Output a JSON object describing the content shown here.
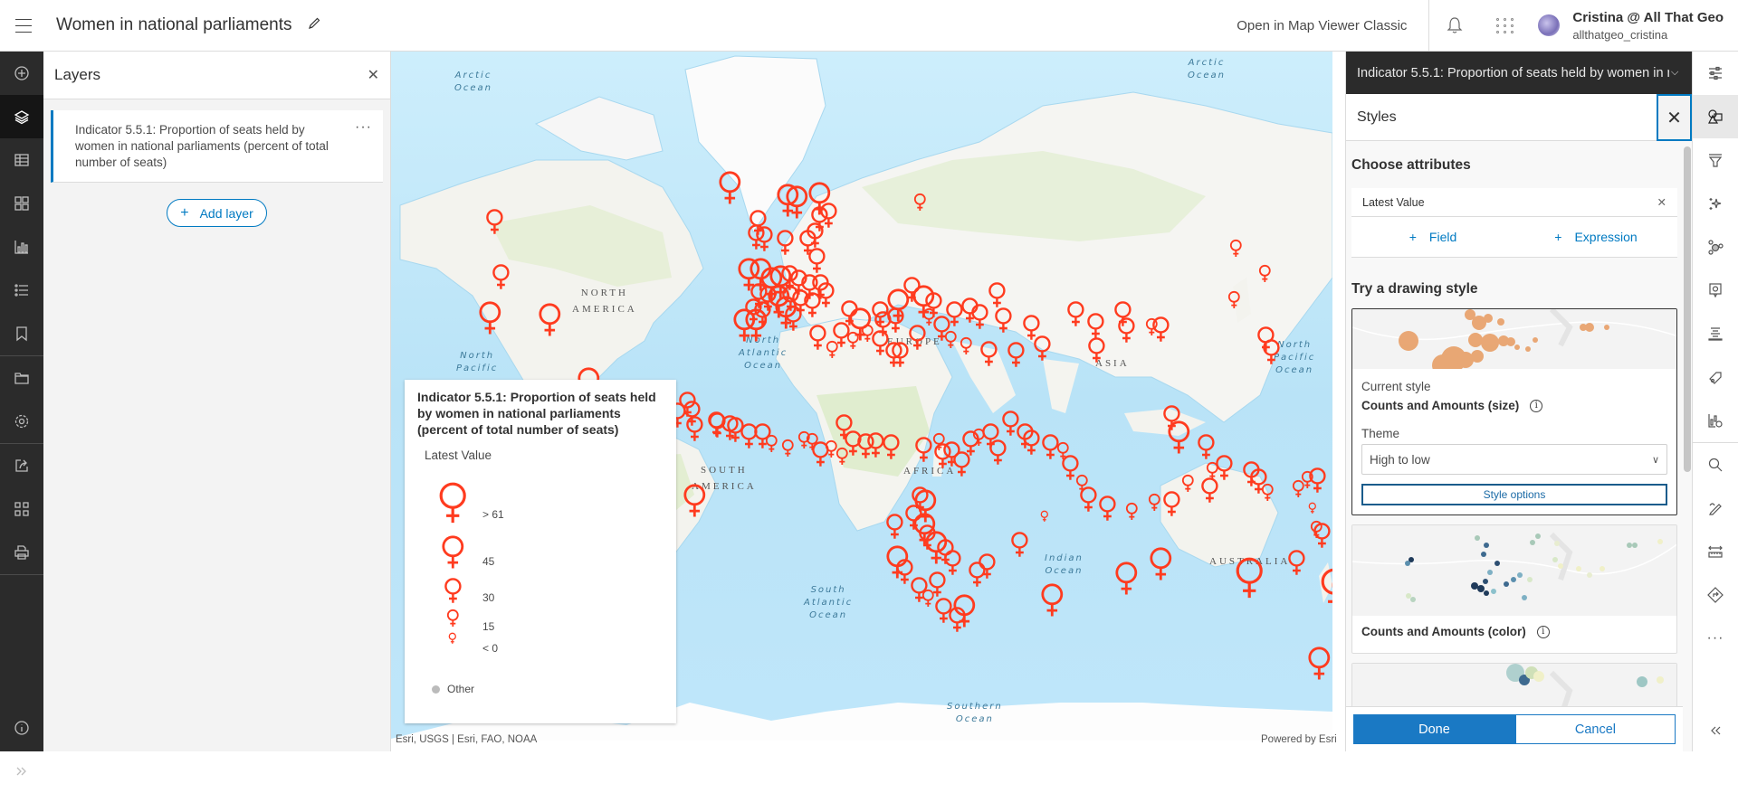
{
  "header": {
    "title": "Women in national parliaments",
    "open_classic": "Open in Map Viewer Classic",
    "user_name": "Cristina @ All That Geo",
    "user_id": "allthatgeo_cristina"
  },
  "left_nav": {
    "items": [
      "add",
      "layers",
      "tables",
      "basemap",
      "charts",
      "legend",
      "bookmarks",
      "open",
      "settings",
      "share",
      "create-app",
      "print",
      "about",
      "expand"
    ]
  },
  "layers_panel": {
    "title": "Layers",
    "layer_name": "Indicator 5.5.1: Proportion of seats held by women in national parliaments (percent of total number of seats)",
    "add_layer": "Add layer"
  },
  "map": {
    "labels": {
      "arctic_1": [
        "Arctic",
        "Ocean"
      ],
      "arctic_2": [
        "Arctic",
        "Ocean"
      ],
      "north_america": [
        "NORTH",
        "AMERICA"
      ],
      "north_pacific_1": [
        "North",
        "Pacific"
      ],
      "north_pacific_2": [
        "North",
        "Pacific",
        "Ocean"
      ],
      "north_atlantic": [
        "North",
        "Atlantic",
        "Ocean"
      ],
      "south_america": [
        "SOUTH",
        "AMERICA"
      ],
      "south_atlantic": [
        "South",
        "Atlantic",
        "Ocean"
      ],
      "europe": "EUROPE",
      "asia": "ASIA",
      "africa": "AFRICA",
      "indian": [
        "Indian",
        "Ocean"
      ],
      "australia": "AUSTRALIA",
      "southern": [
        "Southern",
        "Ocean"
      ]
    },
    "marker_color": "#ff3b1f",
    "attribution": "Esri, USGS | Esri, FAO, NOAA",
    "powered_by": "Powered by Esri"
  },
  "legend": {
    "title": "Indicator 5.5.1: Proportion of seats held by women in national parliaments (percent of total number of seats)",
    "field": "Latest Value",
    "classes": [
      {
        "label": "> 61",
        "value": 61
      },
      {
        "label": "45",
        "value": 45
      },
      {
        "label": "30",
        "value": 30
      },
      {
        "label": "15",
        "value": 15
      },
      {
        "label": "< 0",
        "value": 0
      }
    ],
    "other": "Other"
  },
  "styles_panel": {
    "layer_select": "Indicator 5.5.1: Proportion of seats held by women in national parliaments (percent of total number of seats)",
    "title": "Styles",
    "choose_attributes": "Choose attributes",
    "attribute": "Latest Value",
    "add_field": "Field",
    "add_expression": "Expression",
    "try_style": "Try a drawing style",
    "current_caption": "Current style",
    "current_style": "Counts and Amounts (size)",
    "theme_label": "Theme",
    "theme_value": "High to low",
    "style_options": "Style options",
    "second_style": "Counts and Amounts (color)",
    "done": "Done",
    "cancel": "Cancel"
  },
  "right_nav": {
    "items": [
      "properties",
      "styles",
      "filter",
      "effects",
      "clustering",
      "pop-ups",
      "labels",
      "fields",
      "configure-charts",
      "search",
      "sketch",
      "measurement",
      "directions",
      "more",
      "collapse"
    ]
  }
}
